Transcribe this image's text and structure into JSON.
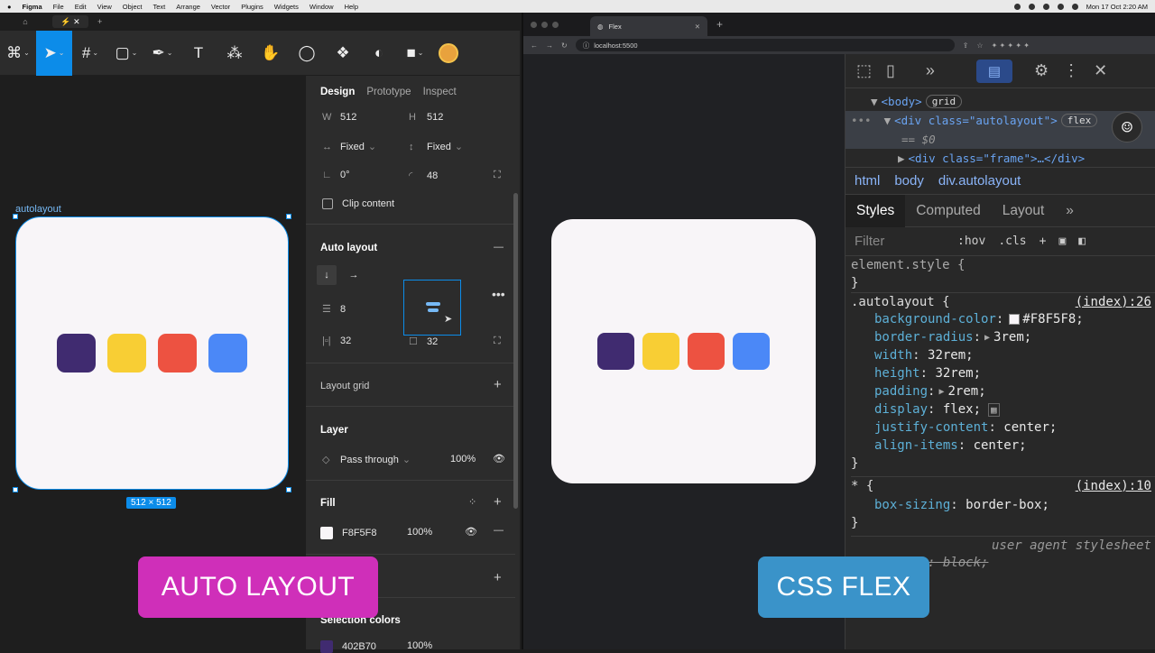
{
  "menubar": {
    "app": "Figma",
    "items": [
      "File",
      "Edit",
      "View",
      "Object",
      "Text",
      "Arrange",
      "Vector",
      "Plugins",
      "Widgets",
      "Window",
      "Help"
    ],
    "clock": "Mon 17 Oct  2:20 AM"
  },
  "figma": {
    "frame_label": "autolayout",
    "size_badge": "512 × 512",
    "panel_tabs": [
      "Design",
      "Prototype",
      "Inspect"
    ],
    "w_label": "W",
    "w": "512",
    "h_label": "H",
    "h": "512",
    "hconstraint": "Fixed",
    "vconstraint": "Fixed",
    "rotation": "0°",
    "radius": "48",
    "clip_content": "Clip content",
    "auto_layout_title": "Auto layout",
    "spacing": "8",
    "pad_h": "32",
    "pad_v": "32",
    "layout_grid_title": "Layout grid",
    "layer_title": "Layer",
    "blend": "Pass through",
    "layer_opacity": "100%",
    "fill_title": "Fill",
    "fill_hex": "F8F5F8",
    "fill_opacity": "100%",
    "selection_colors_title": "Selection colors",
    "sel_color_hex": "402B70",
    "sel_color_opacity": "100%",
    "colors": {
      "purple": "#402B70",
      "yellow": "#F8CE34",
      "red": "#ED5241",
      "blue": "#4B88F7",
      "bg": "#F8F5F8"
    }
  },
  "chrome": {
    "tab_title": "Flex",
    "url": "localhost:5500"
  },
  "devtools": {
    "el_body": "<body>",
    "el_body_badge": "grid",
    "el_div": "<div class=\"autolayout\">",
    "el_div_badge": "flex",
    "el_dollar": "== $0",
    "el_frame": "<div class=\"frame\">…</div>",
    "crumbs": [
      "html",
      "body",
      "div.autolayout"
    ],
    "tabs": [
      "Styles",
      "Computed",
      "Layout"
    ],
    "filter_placeholder": "Filter",
    "hov": ":hov",
    "cls": ".cls",
    "element_style": "element.style {",
    "close_brace": "}",
    "rule_selector": ".autolayout {",
    "rule_source": "(index):26",
    "props": [
      {
        "name": "background-color",
        "value": "#F8F5F8;"
      },
      {
        "name": "border-radius",
        "value": "3rem;"
      },
      {
        "name": "width",
        "value": "32rem;"
      },
      {
        "name": "height",
        "value": "32rem;"
      },
      {
        "name": "padding",
        "value": "2rem;"
      },
      {
        "name": "display",
        "value": "flex;"
      },
      {
        "name": "justify-content",
        "value": "center;"
      },
      {
        "name": "align-items",
        "value": "center;"
      }
    ],
    "star_selector": "* {",
    "star_source": "(index):10",
    "star_prop": "box-sizing",
    "star_value": "border-box;",
    "ua_label": "user agent stylesheet",
    "ua_struck": "display: block;"
  },
  "overlays": {
    "left": "AUTO LAYOUT",
    "left_color": "#CF2FB9",
    "right": "CSS FLEX",
    "right_color": "#3A93C9"
  }
}
